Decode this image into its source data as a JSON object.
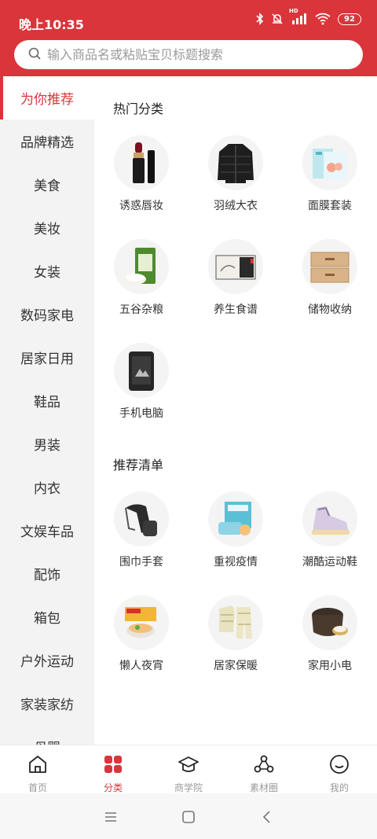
{
  "status_bar": {
    "time": "晚上10:35",
    "battery": "92",
    "network_badge": "HD"
  },
  "search": {
    "placeholder": "输入商品名或粘贴宝贝标题搜索"
  },
  "sidebar": {
    "items": [
      {
        "label": "为你推荐",
        "active": true
      },
      {
        "label": "品牌精选"
      },
      {
        "label": "美食"
      },
      {
        "label": "美妆"
      },
      {
        "label": "女装"
      },
      {
        "label": "数码家电"
      },
      {
        "label": "居家日用"
      },
      {
        "label": "鞋品"
      },
      {
        "label": "男装"
      },
      {
        "label": "内衣"
      },
      {
        "label": "文娱车品"
      },
      {
        "label": "配饰"
      },
      {
        "label": "箱包"
      },
      {
        "label": "户外运动"
      },
      {
        "label": "家装家纺"
      },
      {
        "label": "母婴"
      }
    ]
  },
  "hot_categories": {
    "title": "热门分类",
    "items": [
      {
        "label": "诱惑唇妆",
        "icon": "lipstick-icon"
      },
      {
        "label": "羽绒大衣",
        "icon": "down-jacket-icon"
      },
      {
        "label": "面膜套装",
        "icon": "face-mask-box-icon"
      },
      {
        "label": "五谷杂粮",
        "icon": "rice-bag-icon"
      },
      {
        "label": "养生食谱",
        "icon": "tea-box-icon"
      },
      {
        "label": "储物收纳",
        "icon": "drawer-cabinet-icon"
      },
      {
        "label": "手机电脑",
        "icon": "rugged-phone-icon"
      }
    ]
  },
  "recommend_list": {
    "title": "推荐清单",
    "items": [
      {
        "label": "围巾手套",
        "icon": "scarf-gloves-icon"
      },
      {
        "label": "重视疫情",
        "icon": "face-masks-icon"
      },
      {
        "label": "潮酷运动鞋",
        "icon": "sneaker-icon"
      },
      {
        "label": "懒人夜宵",
        "icon": "instant-noodles-icon"
      },
      {
        "label": "居家保暖",
        "icon": "pajamas-icon"
      },
      {
        "label": "家用小电",
        "icon": "rice-cooker-icon"
      }
    ]
  },
  "bottom_nav": {
    "items": [
      {
        "label": "首页",
        "icon": "home-icon"
      },
      {
        "label": "分类",
        "icon": "category-grid-icon",
        "active": true
      },
      {
        "label": "商学院",
        "icon": "graduation-cap-icon"
      },
      {
        "label": "素材圈",
        "icon": "share-circle-icon"
      },
      {
        "label": "我的",
        "icon": "smiley-face-icon"
      }
    ]
  },
  "colors": {
    "accent": "#d9353a",
    "sidebar_bg": "#f3f3f3",
    "thumb_bg": "#f4f4f4"
  }
}
